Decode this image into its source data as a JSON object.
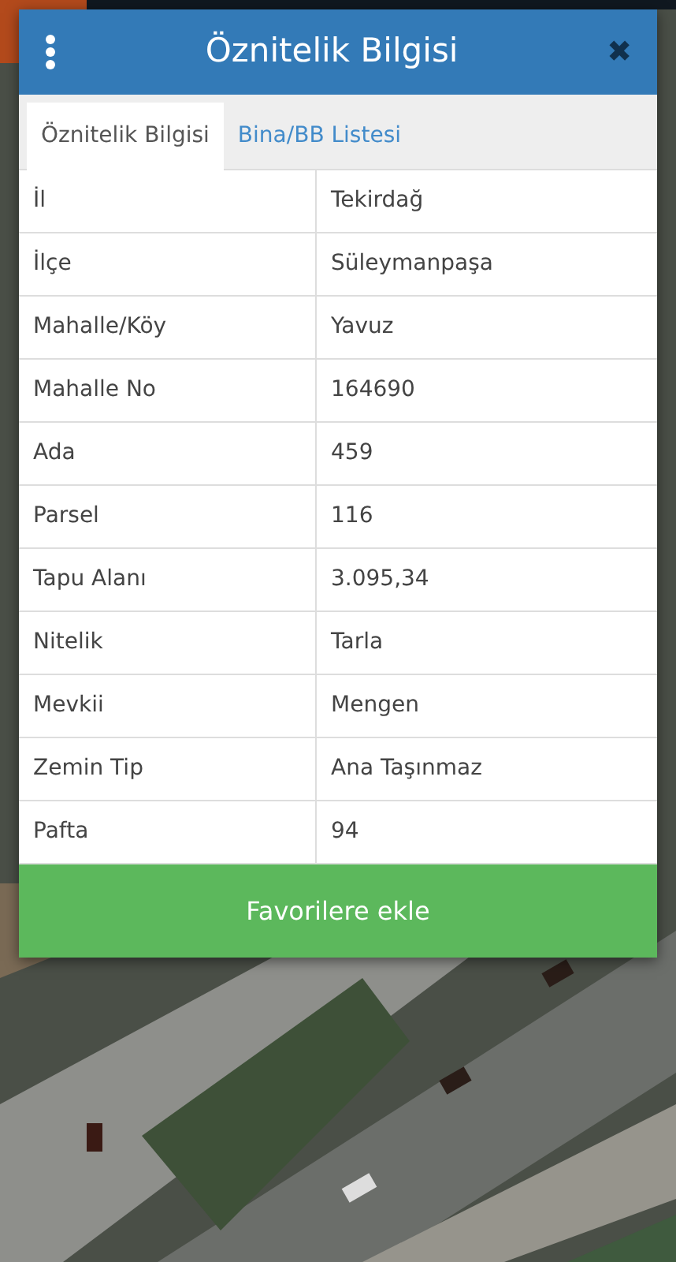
{
  "dialog": {
    "title": "Öznitelik Bilgisi",
    "close": "✖"
  },
  "tabs": [
    {
      "label": "Öznitelik Bilgisi",
      "selected": true
    },
    {
      "label": "Bina/BB Listesi",
      "selected": false
    }
  ],
  "table": {
    "rows": [
      {
        "name": "İl",
        "value": "Tekirdağ"
      },
      {
        "name": "İlçe",
        "value": "Süleymanpaşa"
      },
      {
        "name": "Mahalle/Köy",
        "value": "Yavuz"
      },
      {
        "name": "Mahalle No",
        "value": "164690"
      },
      {
        "name": "Ada",
        "value": "459"
      },
      {
        "name": "Parsel",
        "value": "116"
      },
      {
        "name": "Tapu Alanı",
        "value": "3.095,34"
      },
      {
        "name": "Nitelik",
        "value": "Tarla"
      },
      {
        "name": "Mevkii",
        "value": "Mengen"
      },
      {
        "name": "Zemin Tip",
        "value": "Ana Taşınmaz"
      },
      {
        "name": "Pafta",
        "value": "94"
      }
    ]
  },
  "button": "Favorilere ekle"
}
